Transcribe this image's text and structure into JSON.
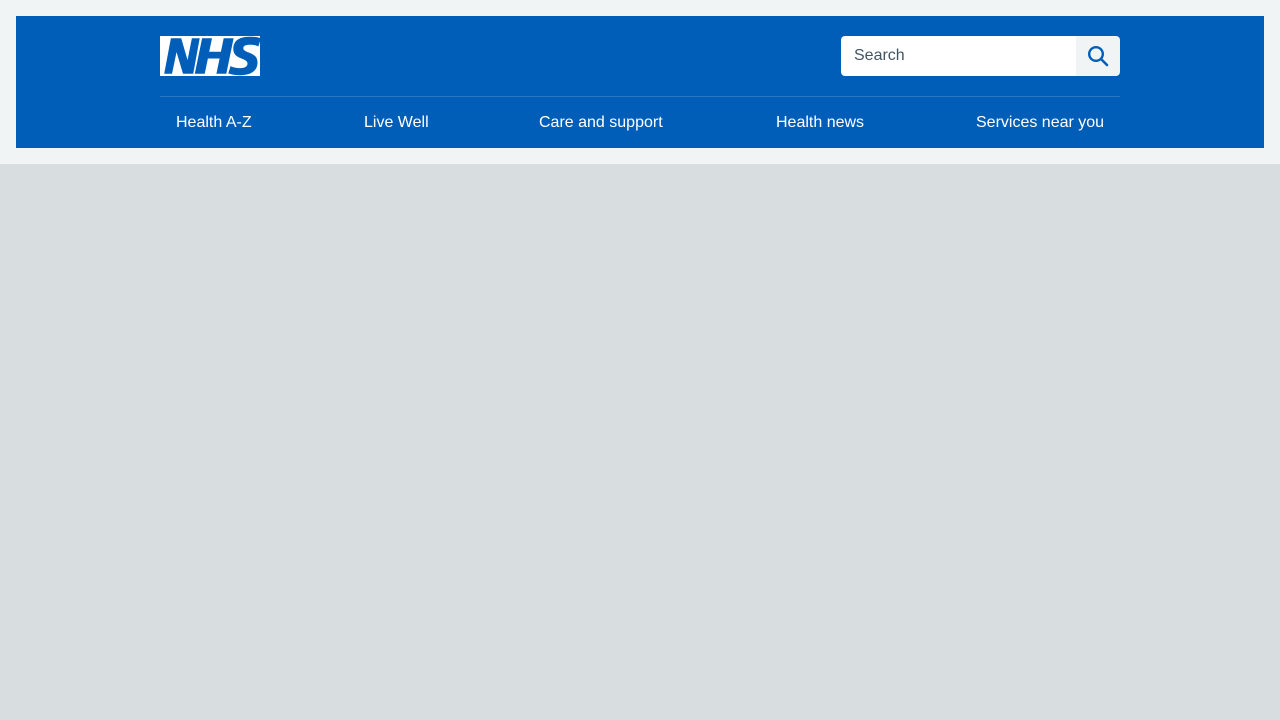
{
  "colors": {
    "header_blue": "#005eb8",
    "page_background": "#d8dde0",
    "top_band": "#f0f4f5",
    "white": "#ffffff"
  },
  "header": {
    "logo_text": "NHS",
    "search": {
      "placeholder": "Search",
      "value": "",
      "button_icon": "search-icon"
    }
  },
  "nav": {
    "items": [
      {
        "label": "Health A-Z"
      },
      {
        "label": "Live Well"
      },
      {
        "label": "Care and support"
      },
      {
        "label": "Health news"
      },
      {
        "label": "Services near you"
      }
    ]
  }
}
